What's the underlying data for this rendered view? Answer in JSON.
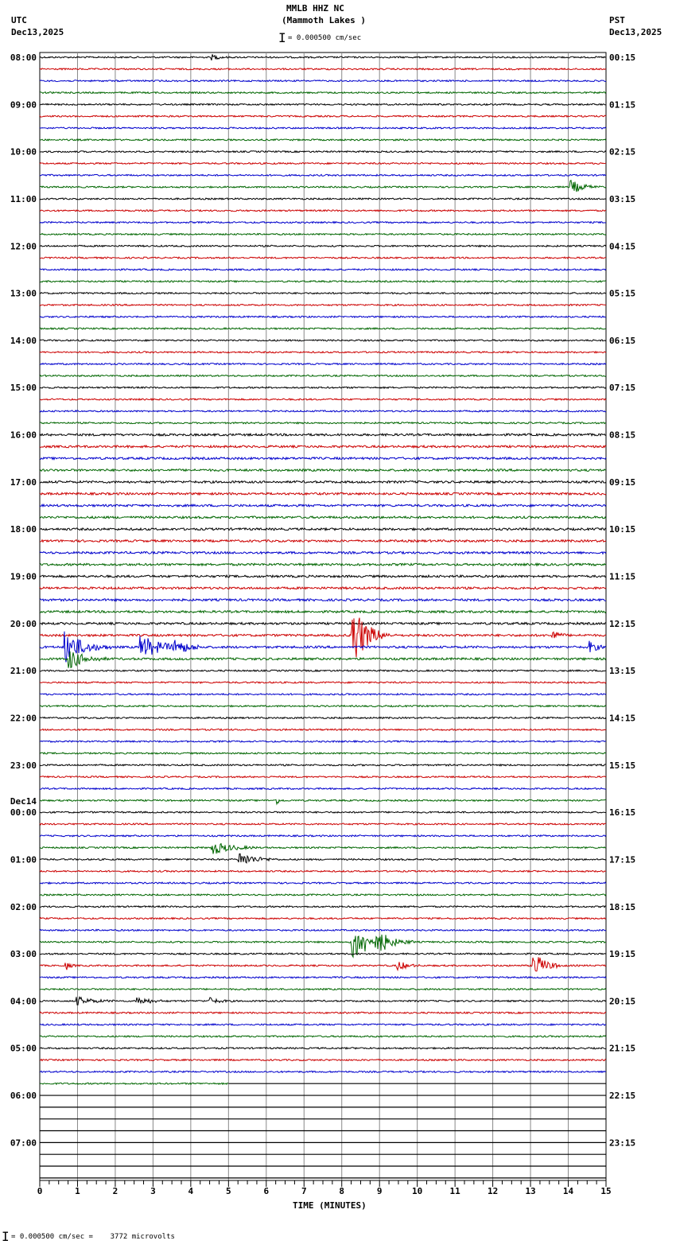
{
  "header": {
    "station": "MMLB HHZ NC",
    "location": "(Mammoth Lakes )",
    "scale": "= 0.000500 cm/sec",
    "left_tz": "UTC",
    "left_date": "Dec13,2025",
    "right_tz": "PST",
    "right_date": "Dec13,2025"
  },
  "footer": {
    "scale_note": "= 0.000500 cm/sec =    3772 microvolts"
  },
  "chart_data": {
    "type": "line",
    "title": "MMLB HHZ NC (Mammoth Lakes )",
    "xlabel": "TIME (MINUTES)",
    "xlim": [
      0,
      15
    ],
    "x_ticks": [
      "0",
      "1",
      "2",
      "3",
      "4",
      "5",
      "6",
      "7",
      "8",
      "9",
      "10",
      "11",
      "12",
      "13",
      "14",
      "15"
    ],
    "rows_per_hour": 4,
    "total_rows": 96,
    "data_end": {
      "row": 87,
      "minute": 5
    },
    "trace_colors": [
      "#000000",
      "#cc0000",
      "#0000cc",
      "#006600"
    ],
    "utc_labels": [
      "08:00",
      "09:00",
      "10:00",
      "11:00",
      "12:00",
      "13:00",
      "14:00",
      "15:00",
      "16:00",
      "17:00",
      "18:00",
      "19:00",
      "20:00",
      "21:00",
      "22:00",
      "23:00",
      "00:00",
      "01:00",
      "02:00",
      "03:00",
      "04:00",
      "05:00",
      "06:00",
      "07:00"
    ],
    "date_change_label": "Dec14",
    "pst_labels": [
      "00:15",
      "01:15",
      "02:15",
      "03:15",
      "04:15",
      "05:15",
      "06:15",
      "07:15",
      "08:15",
      "09:15",
      "10:15",
      "11:15",
      "12:15",
      "13:15",
      "14:15",
      "15:15",
      "16:15",
      "17:15",
      "18:15",
      "19:15",
      "20:15",
      "21:15",
      "22:15",
      "23:15"
    ],
    "events": [
      {
        "row": 0,
        "minute": 4.6,
        "amp": 3,
        "dur": 0.4
      },
      {
        "row": 11,
        "minute": 14.1,
        "amp": 8,
        "dur": 0.8
      },
      {
        "row": 49,
        "minute": 8.3,
        "amp": 40,
        "dur": 1.0
      },
      {
        "row": 49,
        "minute": 13.6,
        "amp": 6,
        "dur": 0.4
      },
      {
        "row": 50,
        "minute": 0.7,
        "amp": 20,
        "dur": 1.2
      },
      {
        "row": 50,
        "minute": 2.7,
        "amp": 14,
        "dur": 1.5
      },
      {
        "row": 50,
        "minute": 3.6,
        "amp": 8,
        "dur": 0.8
      },
      {
        "row": 50,
        "minute": 14.6,
        "amp": 7,
        "dur": 0.4
      },
      {
        "row": 51,
        "minute": 0.8,
        "amp": 12,
        "dur": 1.0
      },
      {
        "row": 63,
        "minute": 6.3,
        "amp": 4,
        "dur": 0.2
      },
      {
        "row": 67,
        "minute": 4.6,
        "amp": 8,
        "dur": 1.2
      },
      {
        "row": 68,
        "minute": 5.3,
        "amp": 9,
        "dur": 1.0
      },
      {
        "row": 75,
        "minute": 8.3,
        "amp": 22,
        "dur": 1.6
      },
      {
        "row": 75,
        "minute": 9.0,
        "amp": 10,
        "dur": 0.5
      },
      {
        "row": 77,
        "minute": 13.1,
        "amp": 16,
        "dur": 0.8
      },
      {
        "row": 77,
        "minute": 9.5,
        "amp": 6,
        "dur": 0.6
      },
      {
        "row": 77,
        "minute": 0.7,
        "amp": 5,
        "dur": 0.3
      },
      {
        "row": 80,
        "minute": 1.0,
        "amp": 5,
        "dur": 1.0
      },
      {
        "row": 80,
        "minute": 2.6,
        "amp": 5,
        "dur": 0.8
      },
      {
        "row": 80,
        "minute": 4.5,
        "amp": 4,
        "dur": 0.6
      }
    ]
  }
}
